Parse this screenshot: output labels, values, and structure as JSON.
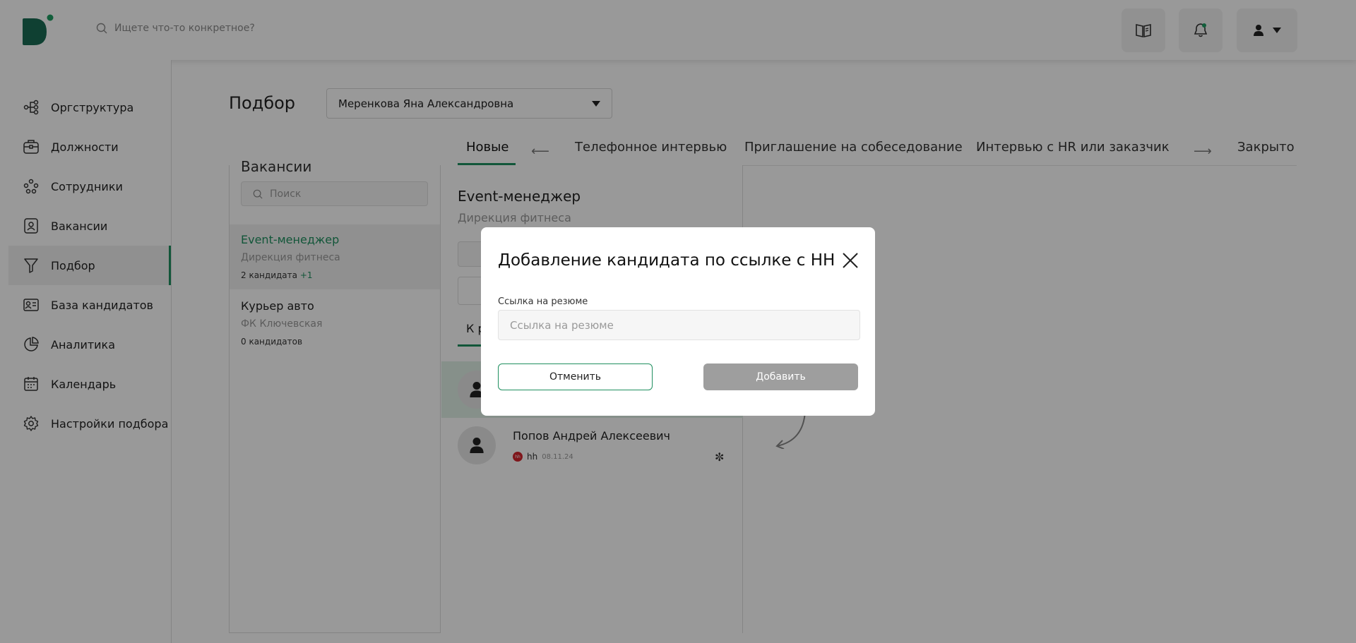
{
  "colors": {
    "accent": "#1f8f5f",
    "logo": "#1a6b54",
    "disabled_button": "#9e9e9e",
    "hh_badge": "#d4262e"
  },
  "header": {
    "search_placeholder": "Ищете что-то конкретное?"
  },
  "sidebar": {
    "items": [
      {
        "label": "Оргструктура",
        "icon": "org-structure-icon"
      },
      {
        "label": "Должности",
        "icon": "briefcase-icon"
      },
      {
        "label": "Сотрудники",
        "icon": "employees-icon"
      },
      {
        "label": "Вакансии",
        "icon": "vacancy-badge-icon"
      },
      {
        "label": "Подбор",
        "icon": "funnel-icon",
        "active": true
      },
      {
        "label": "База кандидатов",
        "icon": "id-card-icon"
      },
      {
        "label": "Аналитика",
        "icon": "pie-chart-icon"
      },
      {
        "label": "Календарь",
        "icon": "calendar-icon"
      },
      {
        "label": "Настройки подбора",
        "icon": "gear-icon"
      }
    ]
  },
  "main": {
    "title": "Подбор",
    "recruiter": "Меренкова Яна Александровна",
    "tabs": [
      "Новые",
      "Телефонное интервью",
      "Приглашение на собеседование",
      "Интервью с HR или заказчик",
      "Закрыто"
    ],
    "tab_arrow_left": "⟵",
    "tab_arrow_right": "⟶"
  },
  "vacancies": {
    "title": "Вакансии",
    "search_placeholder": "Поиск",
    "items": [
      {
        "name": "Event-менеджер",
        "dept": "Дирекция фитнеса",
        "count": "2 кандидата",
        "plus": "+1"
      },
      {
        "name": "Курьер авто",
        "dept": "ФК Ключевская",
        "count": "0 кандидатов",
        "plus": ""
      }
    ]
  },
  "candidates": {
    "title": "Event-менеджер",
    "dept": "Дирекция фитнеса",
    "subtab": "К р",
    "items": [
      {
        "name": "Попов Андрей Алексеевич",
        "source": "hh",
        "badge": "hh",
        "date": "08.11.24"
      }
    ]
  },
  "modal": {
    "title": "Добавление кандидата по ссылке с HH",
    "field_label": "Ссылка на резюме",
    "field_placeholder": "Ссылка на резюме",
    "cancel": "Отменить",
    "add": "Добавить"
  }
}
